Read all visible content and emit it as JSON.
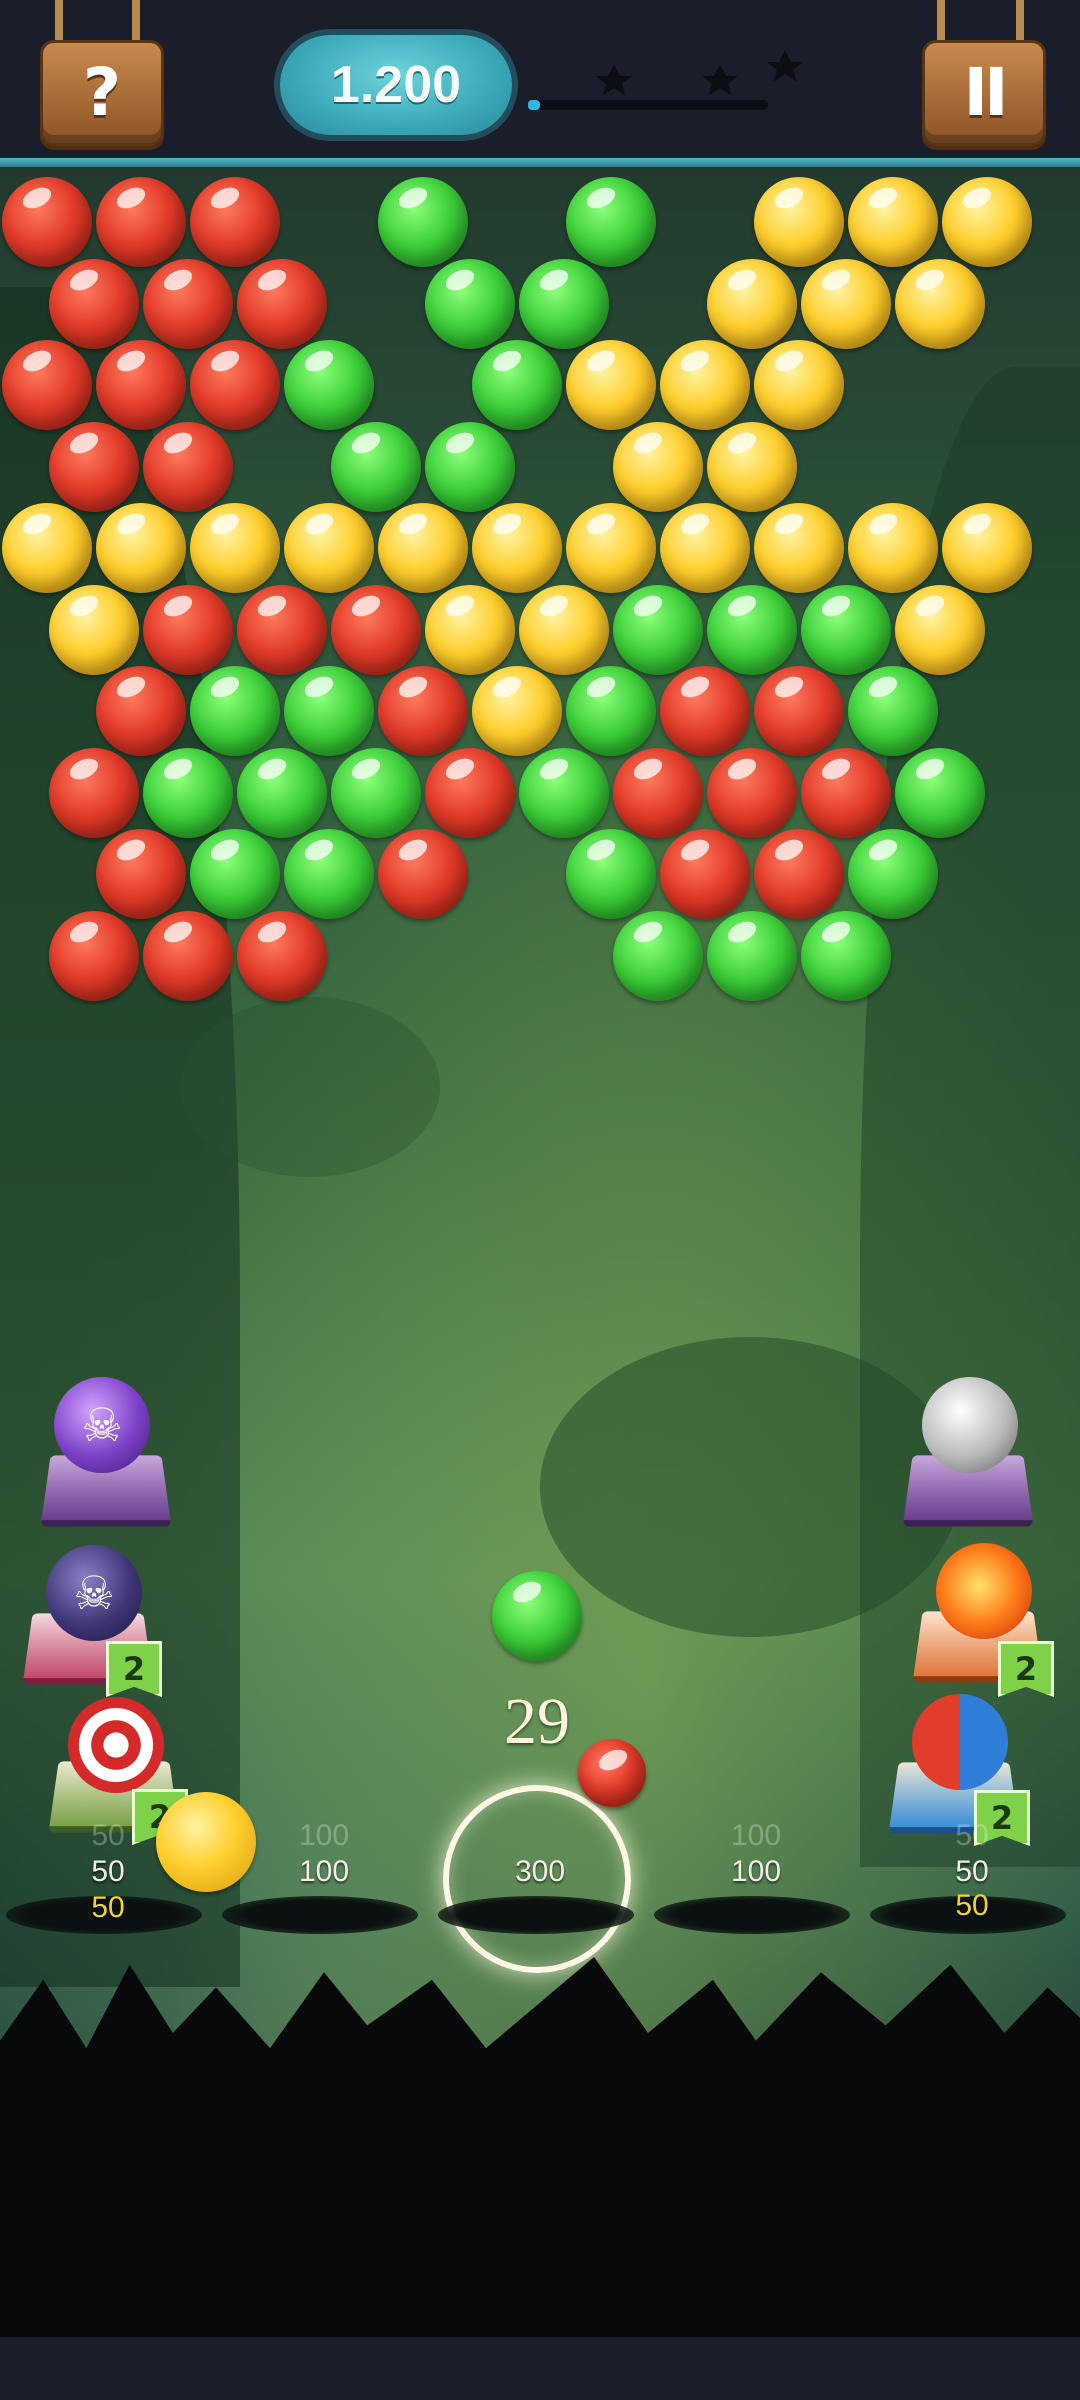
{
  "hud": {
    "help_glyph": "?",
    "pause_glyph": "II",
    "score": "1.200",
    "progress_fraction": 0.05
  },
  "bubbles": {
    "rows": [
      [
        "red",
        "red",
        "red",
        null,
        "green",
        null,
        "green",
        null,
        "yellow",
        "yellow",
        "yellow"
      ],
      [
        "red",
        "red",
        "red",
        null,
        "green",
        "green",
        null,
        "yellow",
        "yellow",
        "yellow"
      ],
      [
        "red",
        "red",
        "red",
        "green",
        null,
        "green",
        "yellow",
        "yellow",
        "yellow",
        null,
        null
      ],
      [
        "red",
        "red",
        null,
        "green",
        "green",
        null,
        "yellow",
        "yellow",
        null,
        null
      ],
      [
        "yellow",
        "yellow",
        "yellow",
        "yellow",
        "yellow",
        "yellow",
        "yellow",
        "yellow",
        "yellow",
        "yellow",
        "yellow"
      ],
      [
        "yellow",
        "red",
        "red",
        "red",
        "yellow",
        "yellow",
        "green",
        "green",
        "green",
        "yellow"
      ],
      [
        null,
        "red",
        "green",
        "green",
        "red",
        "yellow",
        "green",
        "red",
        "red",
        "green",
        null
      ],
      [
        "red",
        "green",
        "green",
        "green",
        "red",
        "green",
        "red",
        "red",
        "red",
        "green"
      ],
      [
        null,
        "red",
        "green",
        "green",
        "red",
        null,
        "green",
        "red",
        "red",
        "green",
        null
      ],
      [
        "red",
        "red",
        "red",
        null,
        null,
        null,
        "green",
        "green",
        "green"
      ]
    ]
  },
  "shooter": {
    "shots_left": "29",
    "current_color": "green",
    "next_color": "red"
  },
  "powerups": {
    "left": [
      {
        "name": "skull-bomb",
        "icon": "skull-bomb-icon",
        "count": ""
      },
      {
        "name": "dark-bomb",
        "icon": "dark-bomb-icon",
        "count": "2"
      },
      {
        "name": "target",
        "icon": "target-icon",
        "count": "2"
      }
    ],
    "right": [
      {
        "name": "stone-ball",
        "icon": "stone-ball-icon",
        "count": ""
      },
      {
        "name": "fireball",
        "icon": "fireball-icon",
        "count": "2"
      },
      {
        "name": "color-swap",
        "icon": "color-swap-icon",
        "count": "2"
      }
    ]
  },
  "pots": [
    {
      "ghost": "50",
      "value": "50",
      "bonus": "50"
    },
    {
      "ghost": "100",
      "value": "100",
      "bonus": ""
    },
    {
      "ghost": "",
      "value": "300",
      "bonus": ""
    },
    {
      "ghost": "100",
      "value": "100",
      "bonus": ""
    },
    {
      "ghost": "50",
      "value": "50",
      "bonus": "50"
    }
  ],
  "colors": {
    "red": "#e23c2a",
    "green": "#3fd13b",
    "yellow": "#ffcf2e",
    "accent": "#3aa9b8",
    "gold": "#f3d42a"
  }
}
